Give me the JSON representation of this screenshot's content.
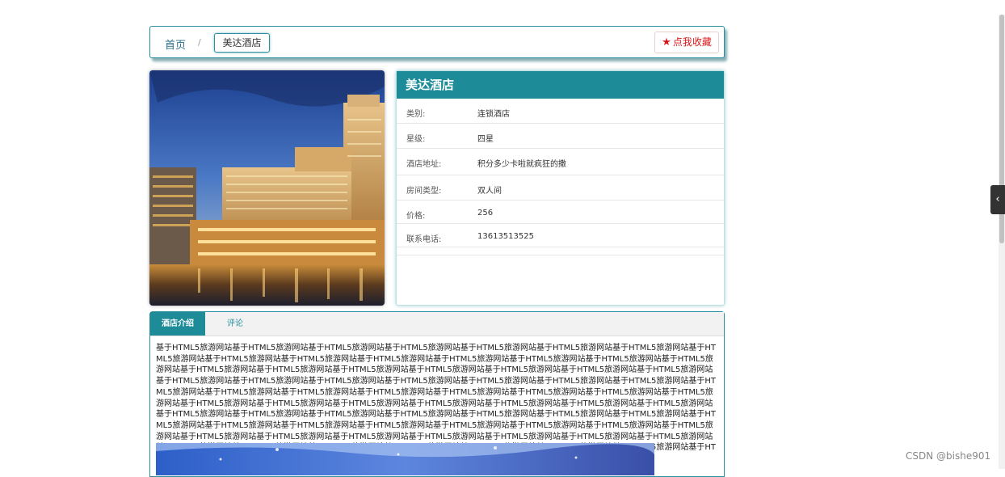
{
  "breadcrumb": {
    "home": "首页",
    "separator": "/",
    "current": "美达酒店"
  },
  "favorite_button": {
    "icon": "star-icon",
    "label": "点我收藏",
    "color": "#d9181c"
  },
  "hotel": {
    "name": "美达酒店",
    "fields": [
      {
        "label": "类别:",
        "value": "连锁酒店"
      },
      {
        "label": "星级:",
        "value": "四星"
      },
      {
        "label": "酒店地址:",
        "value": "积分多少卡啦就疯狂的撒"
      },
      {
        "label": "房间类型:",
        "value": "双人间"
      },
      {
        "label": "价格:",
        "value": "256"
      },
      {
        "label": "联系电话:",
        "value": "13613513525"
      }
    ]
  },
  "tabs": [
    {
      "label": "酒店介绍",
      "active": true
    },
    {
      "label": "评论",
      "active": false
    }
  ],
  "intro_text": "基于HTML5旅游网站基于HTML5旅游网站基于HTML5旅游网站基于HTML5旅游网站基于HTML5旅游网站基于HTML5旅游网站基于HTML5旅游网站基于HTML5旅游网站基于HTML5旅游网站基于HTML5旅游网站基于HTML5旅游网站基于HTML5旅游网站基于HTML5旅游网站基于HTML5旅游网站基于HTML5旅游网站基于HTML5旅游网站基于HTML5旅游网站基于HTML5旅游网站基于HTML5旅游网站基于HTML5旅游网站基于HTML5旅游网站基于HTML5旅游网站基于HTML5旅游网站基于HTML5旅游网站基于HTML5旅游网站基于HTML5旅游网站基于HTML5旅游网站基于HTML5旅游网站基于HTML5旅游网站基于HTML5旅游网站基于HTML5旅游网站基于HTML5旅游网站基于HTML5旅游网站基于HTML5旅游网站基于HTML5旅游网站基于HTML5旅游网站基于HTML5旅游网站基于HTML5旅游网站基于HTML5旅游网站基于HTML5旅游网站基于HTML5旅游网站基于HTML5旅游网站基于HTML5旅游网站基于HTML5旅游网站基于HTML5旅游网站基于HTML5旅游网站基于HTML5旅游网站基于HTML5旅游网站基于HTML5旅游网站基于HTML5旅游网站基于HTML5旅游网站基于HTML5旅游网站基于HTML5旅游网站基于HTML5旅游网站基于HTML5旅游网站基于HTML5旅游网站基于HTML5旅游网站基于HTML5旅游网站基于HTML5旅游网站基于HTML5旅游网站基于HTML5旅游网站基于HTML5旅游网站基于HTML5旅游网站基于HTML5旅游网站基于HTML5旅游网站基于HTML5旅游网站基于HTML5旅游网站基于HTML5旅游网站基于HTML5旅游网站基于HTML5旅游网站基于HTML5旅游网站基于HTML5旅游网站基于HTML5旅游网站基于HTML5旅游网站基于HTML5旅游网站基于HTML5旅游网站基于HTML5旅游网站基于HTML5旅游网站基于HTML5旅游网站",
  "side_toggle": {
    "icon": "chevron-left-icon",
    "glyph": "‹"
  },
  "watermark": "CSDN @bishe901",
  "colors": {
    "accent": "#1d8c98",
    "border": "#2a8f9e"
  }
}
